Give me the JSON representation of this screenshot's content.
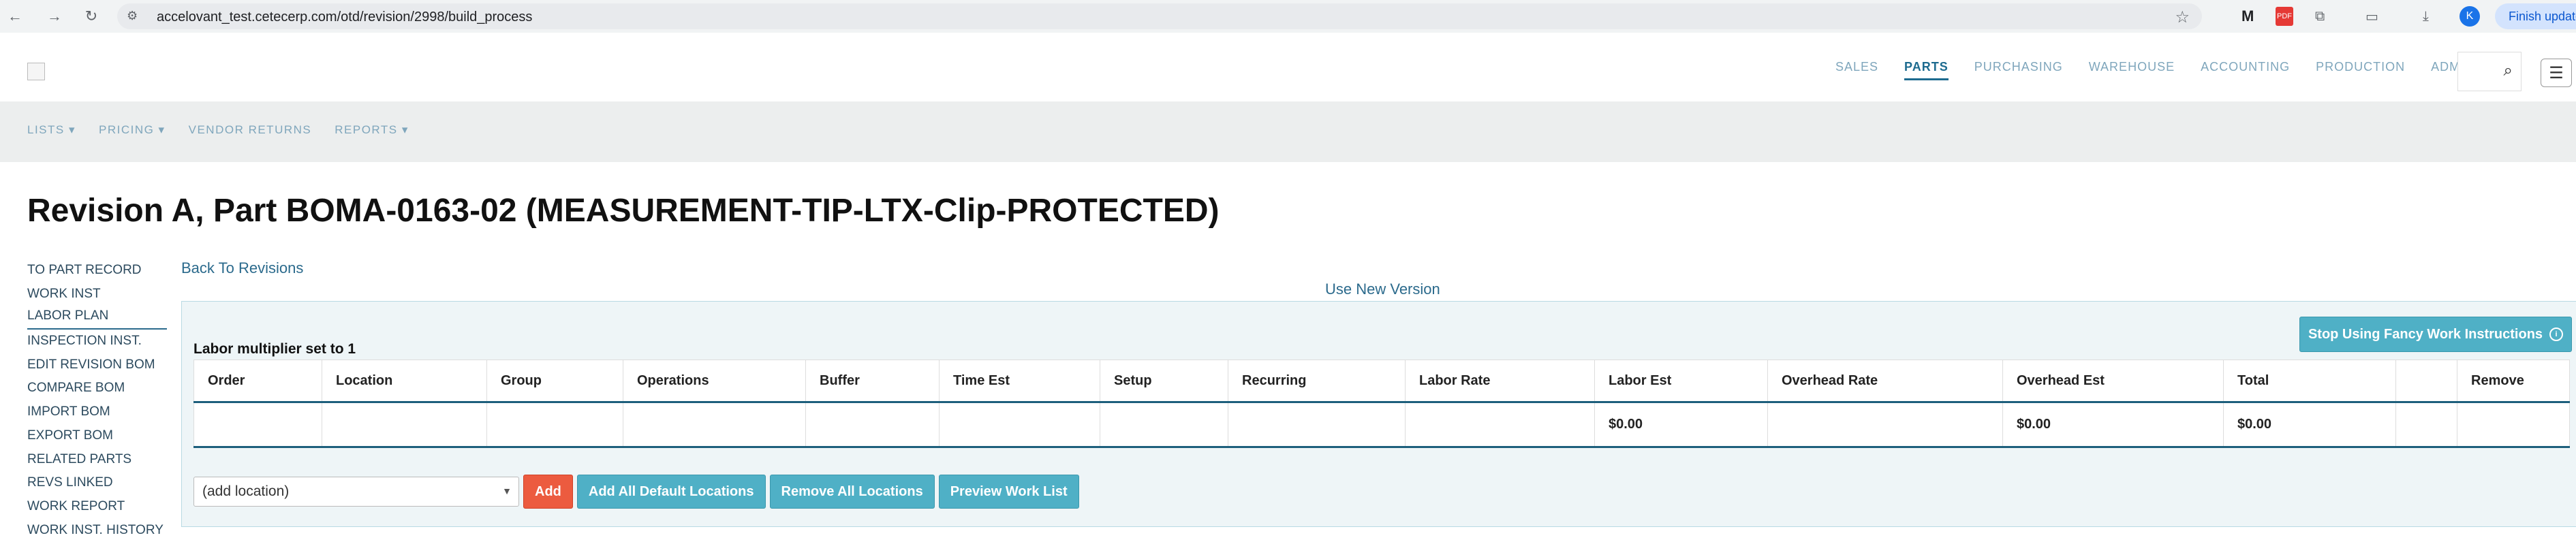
{
  "browser": {
    "url": "accelovant_test.cetecerp.com/otd/revision/2998/build_process",
    "ext_gmail": "M",
    "ext_pdf": "PDF",
    "profile_initial": "K",
    "finish_update": "Finish update"
  },
  "topnav": {
    "items": [
      "SALES",
      "PARTS",
      "PURCHASING",
      "WAREHOUSE",
      "ACCOUNTING",
      "PRODUCTION",
      "ADMIN"
    ],
    "active": "PARTS"
  },
  "subnav": {
    "items": [
      "LISTS ▾",
      "PRICING ▾",
      "VENDOR RETURNS",
      "REPORTS ▾"
    ]
  },
  "page": {
    "title": "Revision A, Part BOMA-0163-02 (MEASUREMENT-TIP-LTX-Clip-PROTECTED)"
  },
  "sidebar": {
    "items": [
      "TO PART RECORD",
      "WORK INST",
      "LABOR PLAN",
      "INSPECTION INST.",
      "EDIT REVISION BOM",
      "COMPARE BOM",
      "IMPORT BOM",
      "EXPORT BOM",
      "RELATED PARTS",
      "REVS LINKED",
      "WORK REPORT",
      "WORK INST. HISTORY"
    ],
    "active": "LABOR PLAN"
  },
  "links": {
    "back": "Back To Revisions",
    "new_version": "Use New Version"
  },
  "panel": {
    "fancy_button": "Stop Using Fancy Work Instructions",
    "multiplier": "Labor multiplier set to 1",
    "table": {
      "columns": [
        "Order",
        "Location",
        "Group",
        "Operations",
        "Buffer",
        "Time Est",
        "Setup",
        "Recurring",
        "Labor Rate",
        "Labor Est",
        "Overhead Rate",
        "Overhead Est",
        "Total",
        "",
        "Remove"
      ],
      "totals": [
        "",
        "",
        "",
        "",
        "",
        "",
        "",
        "",
        "",
        "$0.00",
        "",
        "$0.00",
        "$0.00",
        "",
        ""
      ]
    },
    "location_placeholder": "(add location)",
    "buttons": {
      "add": "Add",
      "add_all": "Add All Default Locations",
      "remove_all": "Remove All Locations",
      "preview": "Preview Work List"
    }
  },
  "colors": {
    "accent_blue": "#4fb0c6",
    "accent_red": "#ec5b3f",
    "nav_active": "#1d6b8f"
  }
}
